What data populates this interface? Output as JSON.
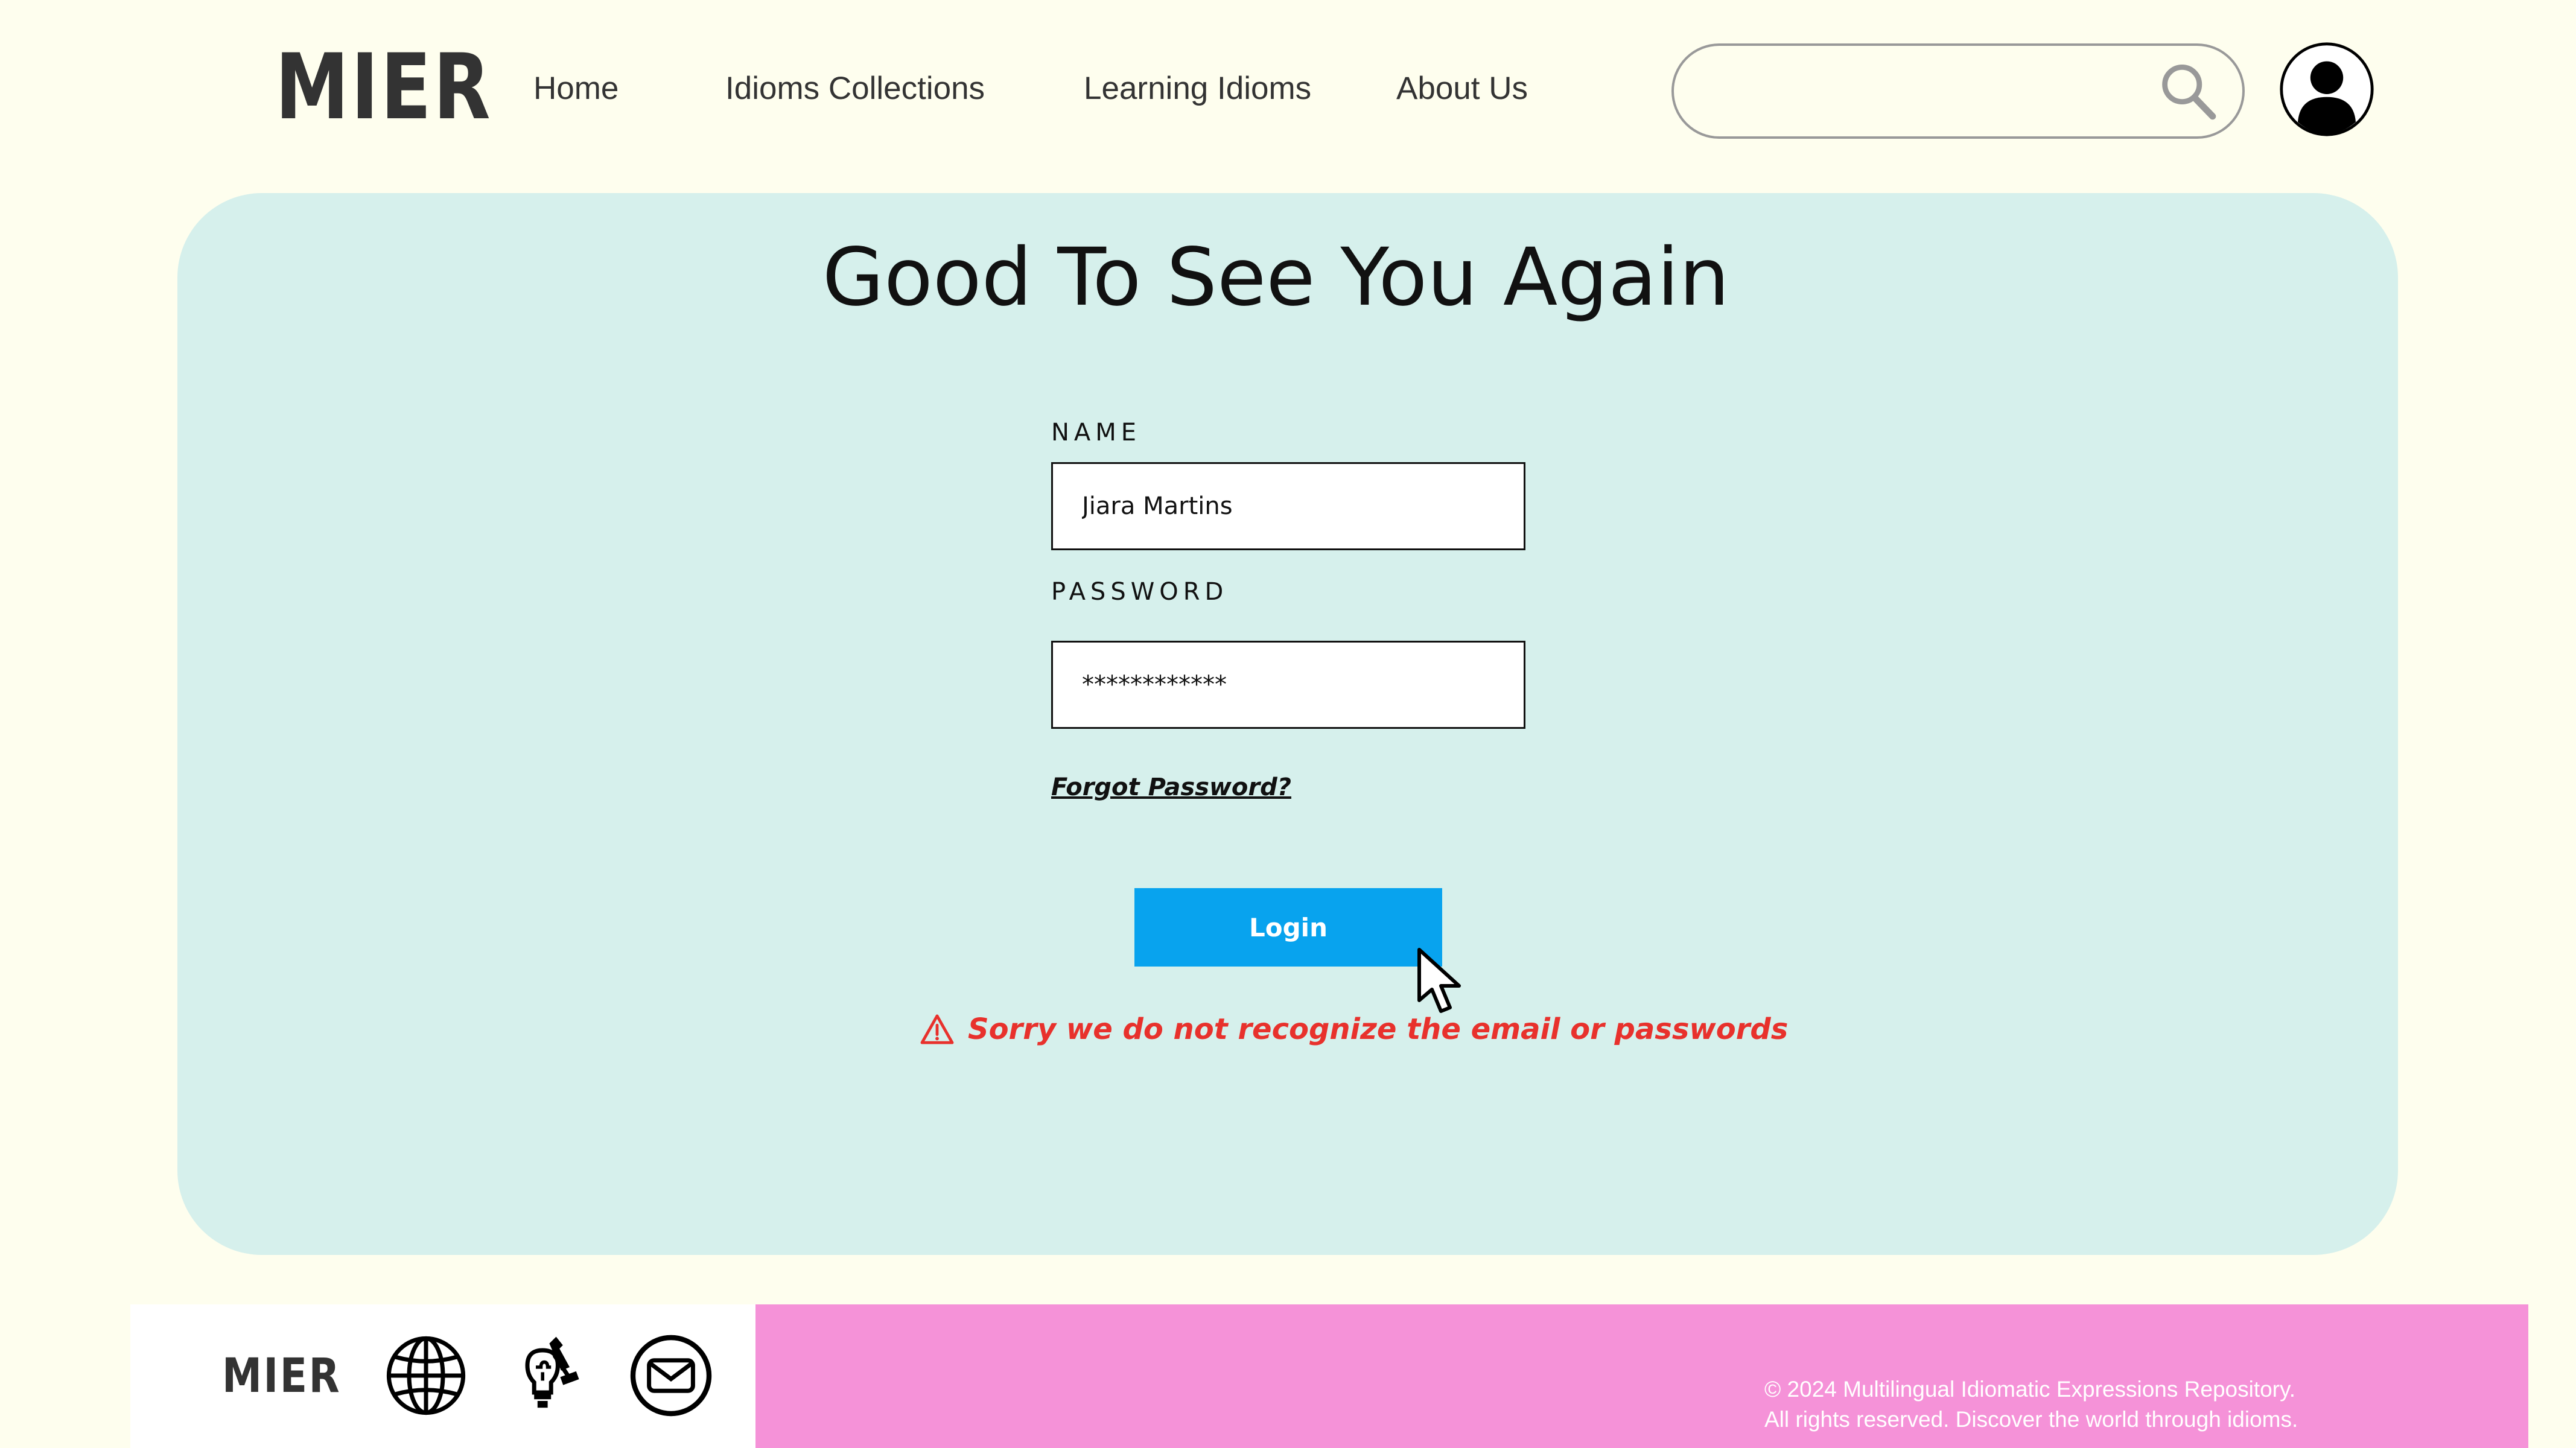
{
  "header": {
    "logo_text": "MIER",
    "nav": [
      {
        "label": "Home"
      },
      {
        "label": "Idioms Collections"
      },
      {
        "label": "Learning Idioms"
      },
      {
        "label": "About Us"
      }
    ],
    "search": {
      "value": "",
      "placeholder": ""
    }
  },
  "login": {
    "title": "Good To See You Again",
    "name_label": "NAME",
    "name_value": "Jiara Martins",
    "password_label": "PASSWORD",
    "password_value": "************",
    "forgot_label": "Forgot Password?",
    "login_label": "Login",
    "error_message": "Sorry we do not recognize the email or passwords"
  },
  "footer": {
    "logo_text": "MIER",
    "copyright_line1": "© 2024 Multilingual Idiomatic Expressions Repository.",
    "copyright_line2": "All rights reserved. Discover the world through idioms."
  },
  "icons": [
    "search-icon",
    "user-avatar-icon",
    "cursor-arrow-icon",
    "warning-icon",
    "globe-icon",
    "lightbulb-puzzle-icon",
    "mail-icon"
  ],
  "colors": {
    "page_background": "#fefeee",
    "card_background": "#d6f0ec",
    "login_button": "#08a3ee",
    "error_text": "#e8312c",
    "footer_pink": "#f592d8"
  }
}
